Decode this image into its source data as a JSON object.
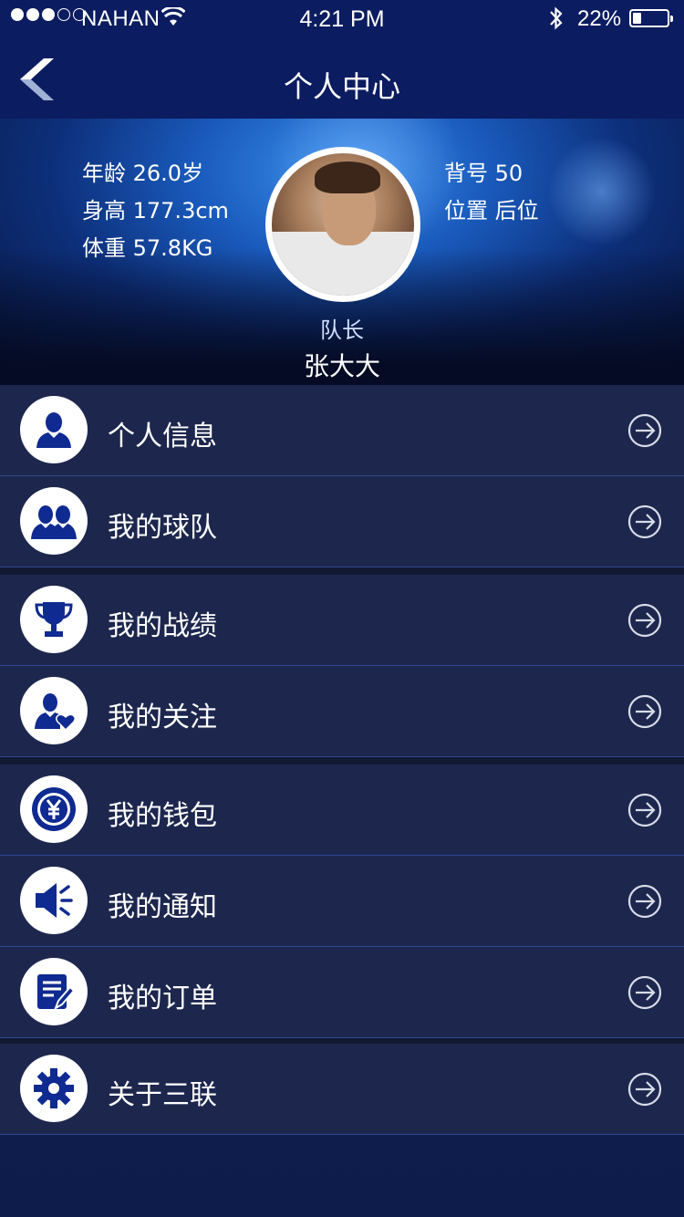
{
  "status_bar": {
    "carrier": "NAHAN",
    "time": "4:21 PM",
    "battery": "22%"
  },
  "nav": {
    "title": "个人中心"
  },
  "profile": {
    "left_stats": [
      "年龄  26.0岁",
      "身高  177.3cm",
      "体重  57.8KG"
    ],
    "right_stats": [
      "背号 50",
      "位置 后位"
    ],
    "role": "队长",
    "name": "张大大"
  },
  "menu": [
    {
      "label": "个人信息",
      "icon": "user-icon"
    },
    {
      "label": "我的球队",
      "icon": "team-icon"
    },
    {
      "label": "我的战绩",
      "icon": "trophy-icon"
    },
    {
      "label": "我的关注",
      "icon": "favorite-user-icon"
    },
    {
      "label": "我的钱包",
      "icon": "yen-coin-icon"
    },
    {
      "label": "我的通知",
      "icon": "speaker-icon"
    },
    {
      "label": "我的订单",
      "icon": "order-icon"
    },
    {
      "label": "关于三联",
      "icon": "gear-icon"
    }
  ],
  "colors": {
    "nav_bg": "#0c1c60",
    "icon_fg": "#0f2a90",
    "list_bg": "#1e284e",
    "divider": "#2c4790"
  }
}
